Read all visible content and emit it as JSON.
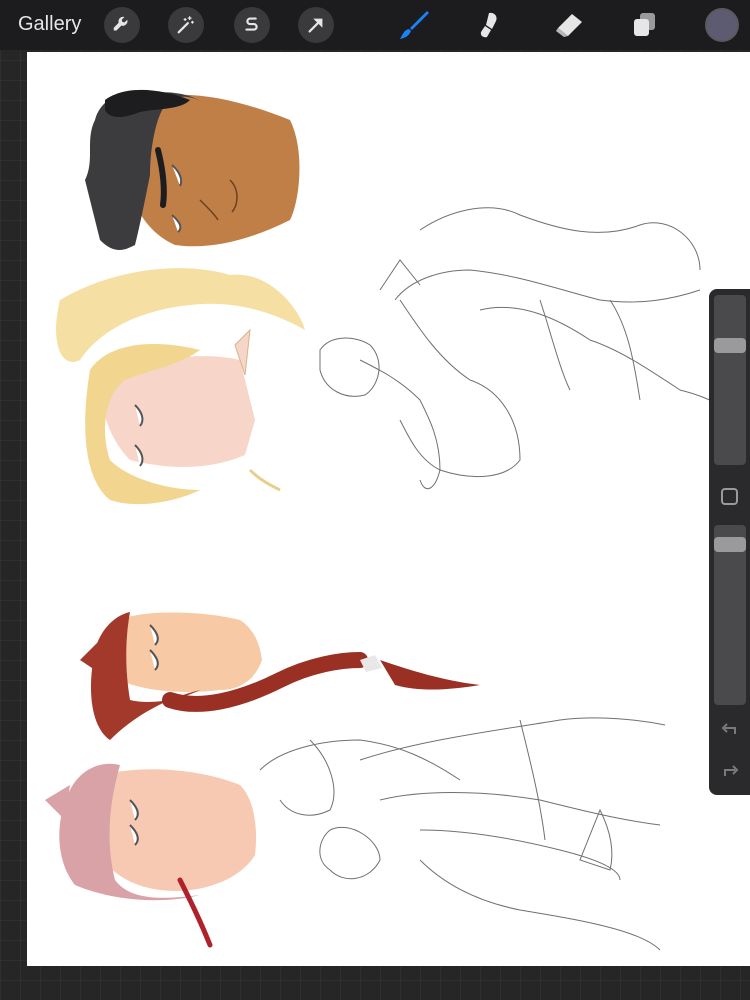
{
  "topbar": {
    "gallery_label": "Gallery",
    "left_tools": [
      "wrench-icon",
      "magic-wand-icon",
      "selection-s-icon",
      "transform-arrow-icon"
    ],
    "right_tools": [
      "brush-icon",
      "smudge-icon",
      "eraser-icon",
      "layers-icon"
    ],
    "active_tool": "brush-icon",
    "active_color": "#5c5b72"
  },
  "colors": {
    "accent": "#1a82f7",
    "toolbar_bg": "#1c1c1e",
    "canvas_bg": "#ffffff"
  },
  "sidebar": {
    "brush_size_level": 0.72,
    "opacity_level": 0.93,
    "icons": [
      "modify-square-icon",
      "undo-icon",
      "redo-icon"
    ]
  }
}
